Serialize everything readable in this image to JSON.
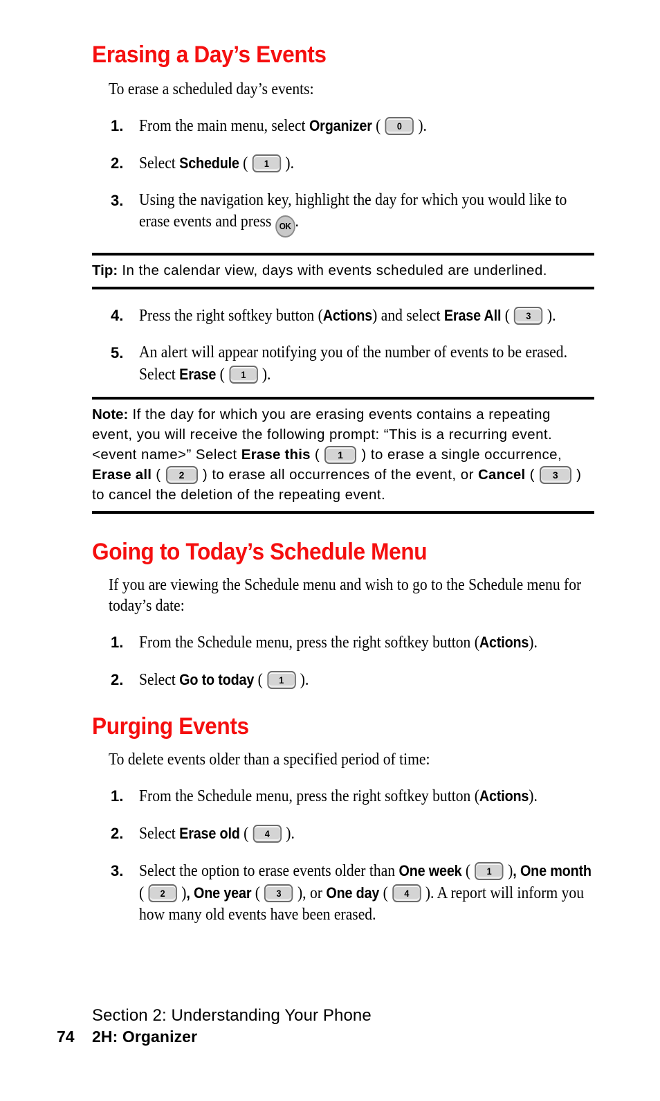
{
  "colors": {
    "heading_red": "#f50f0f",
    "key_fill": "#d4d4d4",
    "key_border": "#6d6d6d",
    "text": "#000000"
  },
  "sections": {
    "erasing": {
      "heading": "Erasing a Day’s Events",
      "intro": "To erase a scheduled day’s events:",
      "step1": {
        "num": "1.",
        "text_a": "From the main menu, select ",
        "bold_b": "Organizer",
        "paren_open": " ( ",
        "key": "0",
        "paren_close": " )."
      },
      "step2": {
        "num": "2.",
        "text_a": "Select ",
        "bold_b": "Schedule",
        "paren_open": " ( ",
        "key": "1",
        "paren_close": " )."
      },
      "step3": {
        "num": "3.",
        "text_a": "Using the navigation key, highlight the day for which you would like to erase events and press ",
        "key_ok": "OK",
        "text_b": "."
      },
      "step4": {
        "num": "4.",
        "text_a": "Press the right softkey button (",
        "bold_b": "Actions",
        "text_c": ") and select ",
        "bold_d": "Erase All",
        "paren_open": " ( ",
        "key": "3",
        "paren_close": " )."
      },
      "step5": {
        "num": "5.",
        "text_a": "An alert will appear notifying you of the number of events to be erased. Select ",
        "bold_b": "Erase",
        "paren_open": " ( ",
        "key": "1",
        "paren_close": " )."
      }
    },
    "tip": {
      "label": "Tip:",
      "text": " In the calendar view, days with events scheduled are underlined."
    },
    "note": {
      "label": "Note:",
      "text_a": " If the day for which you are erasing events contains a repeating event, you will receive the following prompt: “This is a recurring event. <event name>” Select ",
      "bold_b": "Erase this",
      "paren_open_1": " ( ",
      "key_1": "1",
      "paren_close_1": " )",
      "text_c": " to erase a single occurrence, ",
      "bold_d": "Erase all",
      "paren_open_2": " ( ",
      "key_2": "2",
      "paren_close_2": " )",
      "text_e": " to erase all occurrences of the event, or ",
      "bold_f": "Cancel",
      "paren_open_3": " ( ",
      "key_3": "3",
      "paren_close_3": " )",
      "text_g": " to cancel the deletion of the repeating event."
    },
    "going_today": {
      "heading": "Going to Today’s Schedule Menu",
      "intro": "If you are viewing the Schedule menu and wish to go to the Schedule menu for today’s date:",
      "step1": {
        "num": "1.",
        "text_a": "From the Schedule menu, press the right softkey button (",
        "bold_b": "Actions",
        "text_c": ")."
      },
      "step2": {
        "num": "2.",
        "text_a": "Select ",
        "bold_b": "Go to today",
        "paren_open": " ( ",
        "key": "1",
        "paren_close": " )."
      }
    },
    "purging": {
      "heading": "Purging Events",
      "intro": "To delete events older than a specified period of time:",
      "step1": {
        "num": "1.",
        "text_a": "From the Schedule menu, press the right softkey button (",
        "bold_b": "Actions",
        "text_c": ")."
      },
      "step2": {
        "num": "2.",
        "text_a": "Select ",
        "bold_b": "Erase old",
        "paren_open": " ( ",
        "key": "4",
        "paren_close": " )."
      },
      "step3": {
        "num": "3.",
        "text_a": "Select the option to erase events older than ",
        "bold_b": "One week",
        "paren_open_1": " ( ",
        "key_1": "1",
        "paren_close_1": " )",
        "text_c": ", ",
        "bold_d": "One month",
        "paren_open_2": " ( ",
        "key_2": "2",
        "paren_close_2": " )",
        "text_e": ", ",
        "bold_f": "One year",
        "paren_open_3": " ( ",
        "key_3": "3",
        "paren_close_3": " )",
        "text_g": ", or ",
        "bold_h": "One day",
        "paren_open_4": " ( ",
        "key_4": "4",
        "paren_close_4": " )",
        "text_i": ". A report will inform you how many old events have been erased."
      }
    }
  },
  "footer": {
    "section_line": "Section 2: Understanding Your Phone",
    "page_number": "74",
    "chapter": "2H: Organizer"
  }
}
